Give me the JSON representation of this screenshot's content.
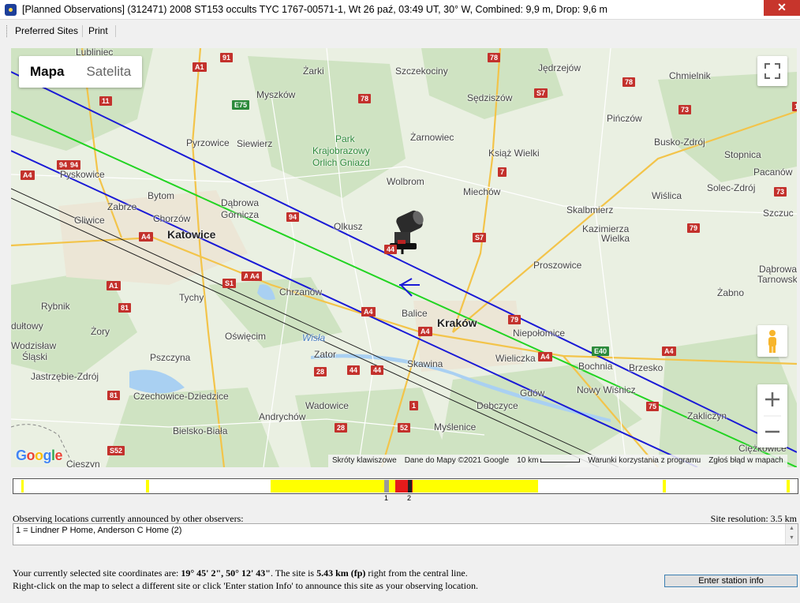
{
  "window": {
    "title": "[Planned Observations] (312471) 2008 ST153 occults TYC 1767-00571-1, Wt 26 paź, 03:49 UT, 30° W, Combined:  9,9 m, Drop:  9,6 m",
    "close_glyph": "✕"
  },
  "menu": {
    "items": [
      "Preferred Sites",
      "Print"
    ]
  },
  "map": {
    "type_buttons": {
      "map": "Mapa",
      "satellite": "Satelita"
    },
    "places": [
      {
        "text": "Lubliniec",
        "style": ""
      },
      {
        "text": "Żarki",
        "style": ""
      },
      {
        "text": "Szczekociny",
        "style": ""
      },
      {
        "text": "Jędrzejów",
        "style": ""
      },
      {
        "text": "Chmielnik",
        "style": ""
      },
      {
        "text": "Myszków",
        "style": ""
      },
      {
        "text": "Sędziszów",
        "style": ""
      },
      {
        "text": "Pińczów",
        "style": ""
      },
      {
        "text": "Żarnowiec",
        "style": ""
      },
      {
        "text": "Pyrzowice",
        "style": ""
      },
      {
        "text": "Siewierz",
        "style": ""
      },
      {
        "text": "Park",
        "style": "green"
      },
      {
        "text": "Krajobrazowy",
        "style": "green"
      },
      {
        "text": "Orlich Gniazd",
        "style": "green"
      },
      {
        "text": "Książ Wielki",
        "style": ""
      },
      {
        "text": "Busko-Zdrój",
        "style": ""
      },
      {
        "text": "Stopnica",
        "style": ""
      },
      {
        "text": "Pacanów",
        "style": ""
      },
      {
        "text": "Pyskowice",
        "style": ""
      },
      {
        "text": "Wolbrom",
        "style": ""
      },
      {
        "text": "Miechów",
        "style": ""
      },
      {
        "text": "Wiślica",
        "style": ""
      },
      {
        "text": "Solec-Zdrój",
        "style": ""
      },
      {
        "text": "Bytom",
        "style": ""
      },
      {
        "text": "Dąbrowa",
        "style": ""
      },
      {
        "text": "Górnicza",
        "style": ""
      },
      {
        "text": "Zabrze",
        "style": ""
      },
      {
        "text": "Skalbmierz",
        "style": ""
      },
      {
        "text": "Szczuc",
        "style": ""
      },
      {
        "text": "Gliwice",
        "style": ""
      },
      {
        "text": "Chorzów",
        "style": ""
      },
      {
        "text": "Kazimierza",
        "style": ""
      },
      {
        "text": "Wielka",
        "style": ""
      },
      {
        "text": "Katowice",
        "style": "big"
      },
      {
        "text": "Olkusz",
        "style": ""
      },
      {
        "text": "Proszowice",
        "style": ""
      },
      {
        "text": "Dąbrowa",
        "style": ""
      },
      {
        "text": "Tarnowska",
        "style": ""
      },
      {
        "text": "Tychy",
        "style": ""
      },
      {
        "text": "Chrzanów",
        "style": ""
      },
      {
        "text": "Żabno",
        "style": ""
      },
      {
        "text": "Rybnik",
        "style": ""
      },
      {
        "text": "Balice",
        "style": ""
      },
      {
        "text": "Kraków",
        "style": "big"
      },
      {
        "text": "Niepołomice",
        "style": ""
      },
      {
        "text": "Żory",
        "style": ""
      },
      {
        "text": "Oświęcim",
        "style": ""
      },
      {
        "text": "Wodzisław",
        "style": ""
      },
      {
        "text": "Śląski",
        "style": ""
      },
      {
        "text": "Wisła",
        "style": "river"
      },
      {
        "text": "Tar",
        "style": ""
      },
      {
        "text": "Zator",
        "style": ""
      },
      {
        "text": "Pszczyna",
        "style": ""
      },
      {
        "text": "Skawina",
        "style": ""
      },
      {
        "text": "Wieliczka",
        "style": ""
      },
      {
        "text": "Bochnia",
        "style": ""
      },
      {
        "text": "Brzesko",
        "style": ""
      },
      {
        "text": "Jastrzębie-Zdrój",
        "style": ""
      },
      {
        "text": "Gdów",
        "style": ""
      },
      {
        "text": "Nowy Wiśnicz",
        "style": ""
      },
      {
        "text": "Czechowice-Dziedzice",
        "style": ""
      },
      {
        "text": "Dobczyce",
        "style": ""
      },
      {
        "text": "Wadowice",
        "style": ""
      },
      {
        "text": "Zakliczyn",
        "style": ""
      },
      {
        "text": "Andrychów",
        "style": ""
      },
      {
        "text": "Myślenice",
        "style": ""
      },
      {
        "text": "Bielsko-Biała",
        "style": ""
      },
      {
        "text": "Ciężkowice",
        "style": ""
      },
      {
        "text": "Cieszyn",
        "style": ""
      },
      {
        "text": "dułtowy",
        "style": ""
      }
    ],
    "road_numbers": [
      {
        "text": "91",
        "style": ""
      },
      {
        "text": "A1",
        "style": ""
      },
      {
        "text": "78",
        "style": ""
      },
      {
        "text": "11",
        "style": ""
      },
      {
        "text": "E75",
        "style": "green"
      },
      {
        "text": "78",
        "style": ""
      },
      {
        "text": "78",
        "style": ""
      },
      {
        "text": "S7",
        "style": ""
      },
      {
        "text": "73",
        "style": ""
      },
      {
        "text": "94",
        "style": ""
      },
      {
        "text": "A4",
        "style": ""
      },
      {
        "text": "7",
        "style": ""
      },
      {
        "text": "73",
        "style": ""
      },
      {
        "text": "94",
        "style": ""
      },
      {
        "text": "S7",
        "style": ""
      },
      {
        "text": "79",
        "style": ""
      },
      {
        "text": "A4",
        "style": ""
      },
      {
        "text": "A4",
        "style": ""
      },
      {
        "text": "44",
        "style": ""
      },
      {
        "text": "A4",
        "style": ""
      },
      {
        "text": "S1",
        "style": ""
      },
      {
        "text": "A1",
        "style": ""
      },
      {
        "text": "81",
        "style": ""
      },
      {
        "text": "A4",
        "style": ""
      },
      {
        "text": "79",
        "style": ""
      },
      {
        "text": "A4",
        "style": ""
      },
      {
        "text": "E40",
        "style": "green"
      },
      {
        "text": "A4",
        "style": ""
      },
      {
        "text": "A4",
        "style": ""
      },
      {
        "text": "A4",
        "style": ""
      },
      {
        "text": "28",
        "style": ""
      },
      {
        "text": "44",
        "style": ""
      },
      {
        "text": "44",
        "style": ""
      },
      {
        "text": "81",
        "style": ""
      },
      {
        "text": "1",
        "style": ""
      },
      {
        "text": "75",
        "style": ""
      },
      {
        "text": "28",
        "style": ""
      },
      {
        "text": "52",
        "style": ""
      },
      {
        "text": "S52",
        "style": ""
      },
      {
        "text": "1",
        "style": ""
      },
      {
        "text": "94",
        "style": ""
      }
    ],
    "google_logo": "Google",
    "attribution": {
      "shortcuts": "Skróty klawiszowe",
      "map_data": "Dane do Mapy ©2021 Google",
      "scale": "10 km",
      "terms": "Warunki korzystania z programu",
      "report": "Zgłoś błąd w mapach"
    }
  },
  "timeline": {
    "labels": [
      "1",
      "2"
    ]
  },
  "announcements": {
    "label": "Observing locations currently announced by other observers:",
    "site_resolution": "Site resolution: 3.5 km",
    "items": [
      "1 = Lindner P Home, Anderson C Home (2)"
    ]
  },
  "selected_site": {
    "prefix": "Your currently selected site coordinates are: ",
    "coords": "19° 45' 2\", 50° 12' 43\"",
    "mid": ". The site is ",
    "distance": "5.43 km (fp)",
    "suffix": " right from the central line.",
    "line2": "Right-click on the map to select a different site or click 'Enter station Info' to announce this site as your observing location."
  },
  "buttons": {
    "enter_station": "Enter station info"
  },
  "colors": {
    "path_edge": "#1a1ad6",
    "central_line": "#22d422",
    "sigma_line": "#222222",
    "timeline_yellow": "#ffff00",
    "timeline_red": "#e51b1b",
    "close_button": "#c7352c"
  }
}
